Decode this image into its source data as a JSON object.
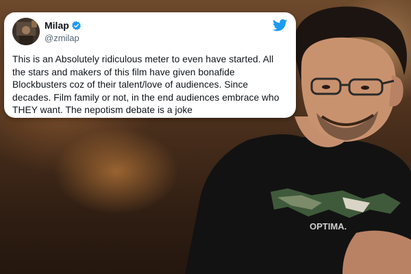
{
  "tweet": {
    "display_name": "Milap",
    "handle": "@zmilap",
    "text": "This is an Absolutely ridiculous meter to even have started. All the stars and makers of this film have given bonafide Blockbusters coz of their talent/love of audiences. Since decades. Film family or not, in the end audiences embrace who THEY want. The nepotism debate is a joke"
  },
  "icons": {
    "verified": "verified-badge-icon",
    "brand": "twitter-bird-icon"
  },
  "colors": {
    "twitter_blue": "#1d9bf0",
    "text": "#0f1419",
    "handle": "#536471"
  }
}
